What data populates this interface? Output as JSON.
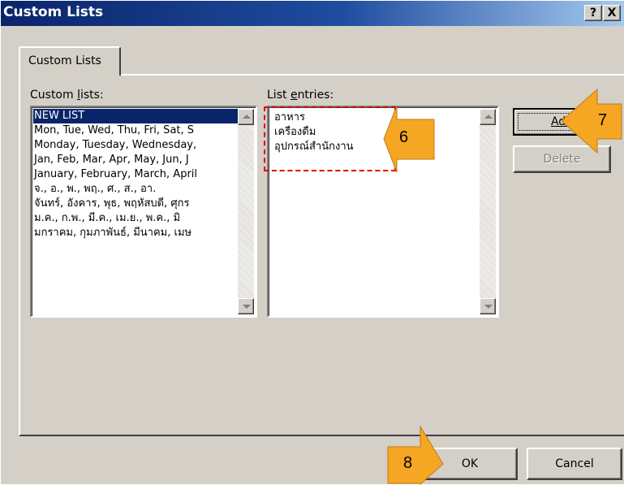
{
  "window": {
    "title": "Custom Lists",
    "help_label": "?",
    "close_label": "X"
  },
  "tab": {
    "label": "Custom Lists"
  },
  "custom_lists": {
    "label_pre": "Custom ",
    "label_access": "l",
    "label_post": "ists:",
    "items": [
      "NEW LIST",
      "Mon, Tue, Wed, Thu, Fri, Sat, S",
      "Monday, Tuesday, Wednesday,",
      "Jan, Feb, Mar, Apr, May, Jun, J",
      "January, February, March, April",
      "จ., อ., พ., พฤ., ศ., ส., อา.",
      "จันทร์, อังคาร, พุธ, พฤหัสบดี, ศุกร",
      "ม.ค., ก.พ., มี.ค., เม.ย., พ.ค., มิ",
      "มกราคม, กุมภาพันธ์, มีนาคม, เมษ"
    ],
    "selected_index": 0
  },
  "list_entries": {
    "label_pre": "List ",
    "label_access": "e",
    "label_post": "ntries:",
    "items": [
      "อาหาร",
      "เครื่องดื่ม",
      "อุปกรณ์สำนักงาน"
    ]
  },
  "buttons": {
    "add": "Add",
    "delete": "Delete",
    "ok": "OK",
    "cancel": "Cancel"
  },
  "callouts": {
    "step6": "6",
    "step7": "7",
    "step8": "8",
    "color": "#f5a623",
    "highlight_color": "#e00000"
  }
}
